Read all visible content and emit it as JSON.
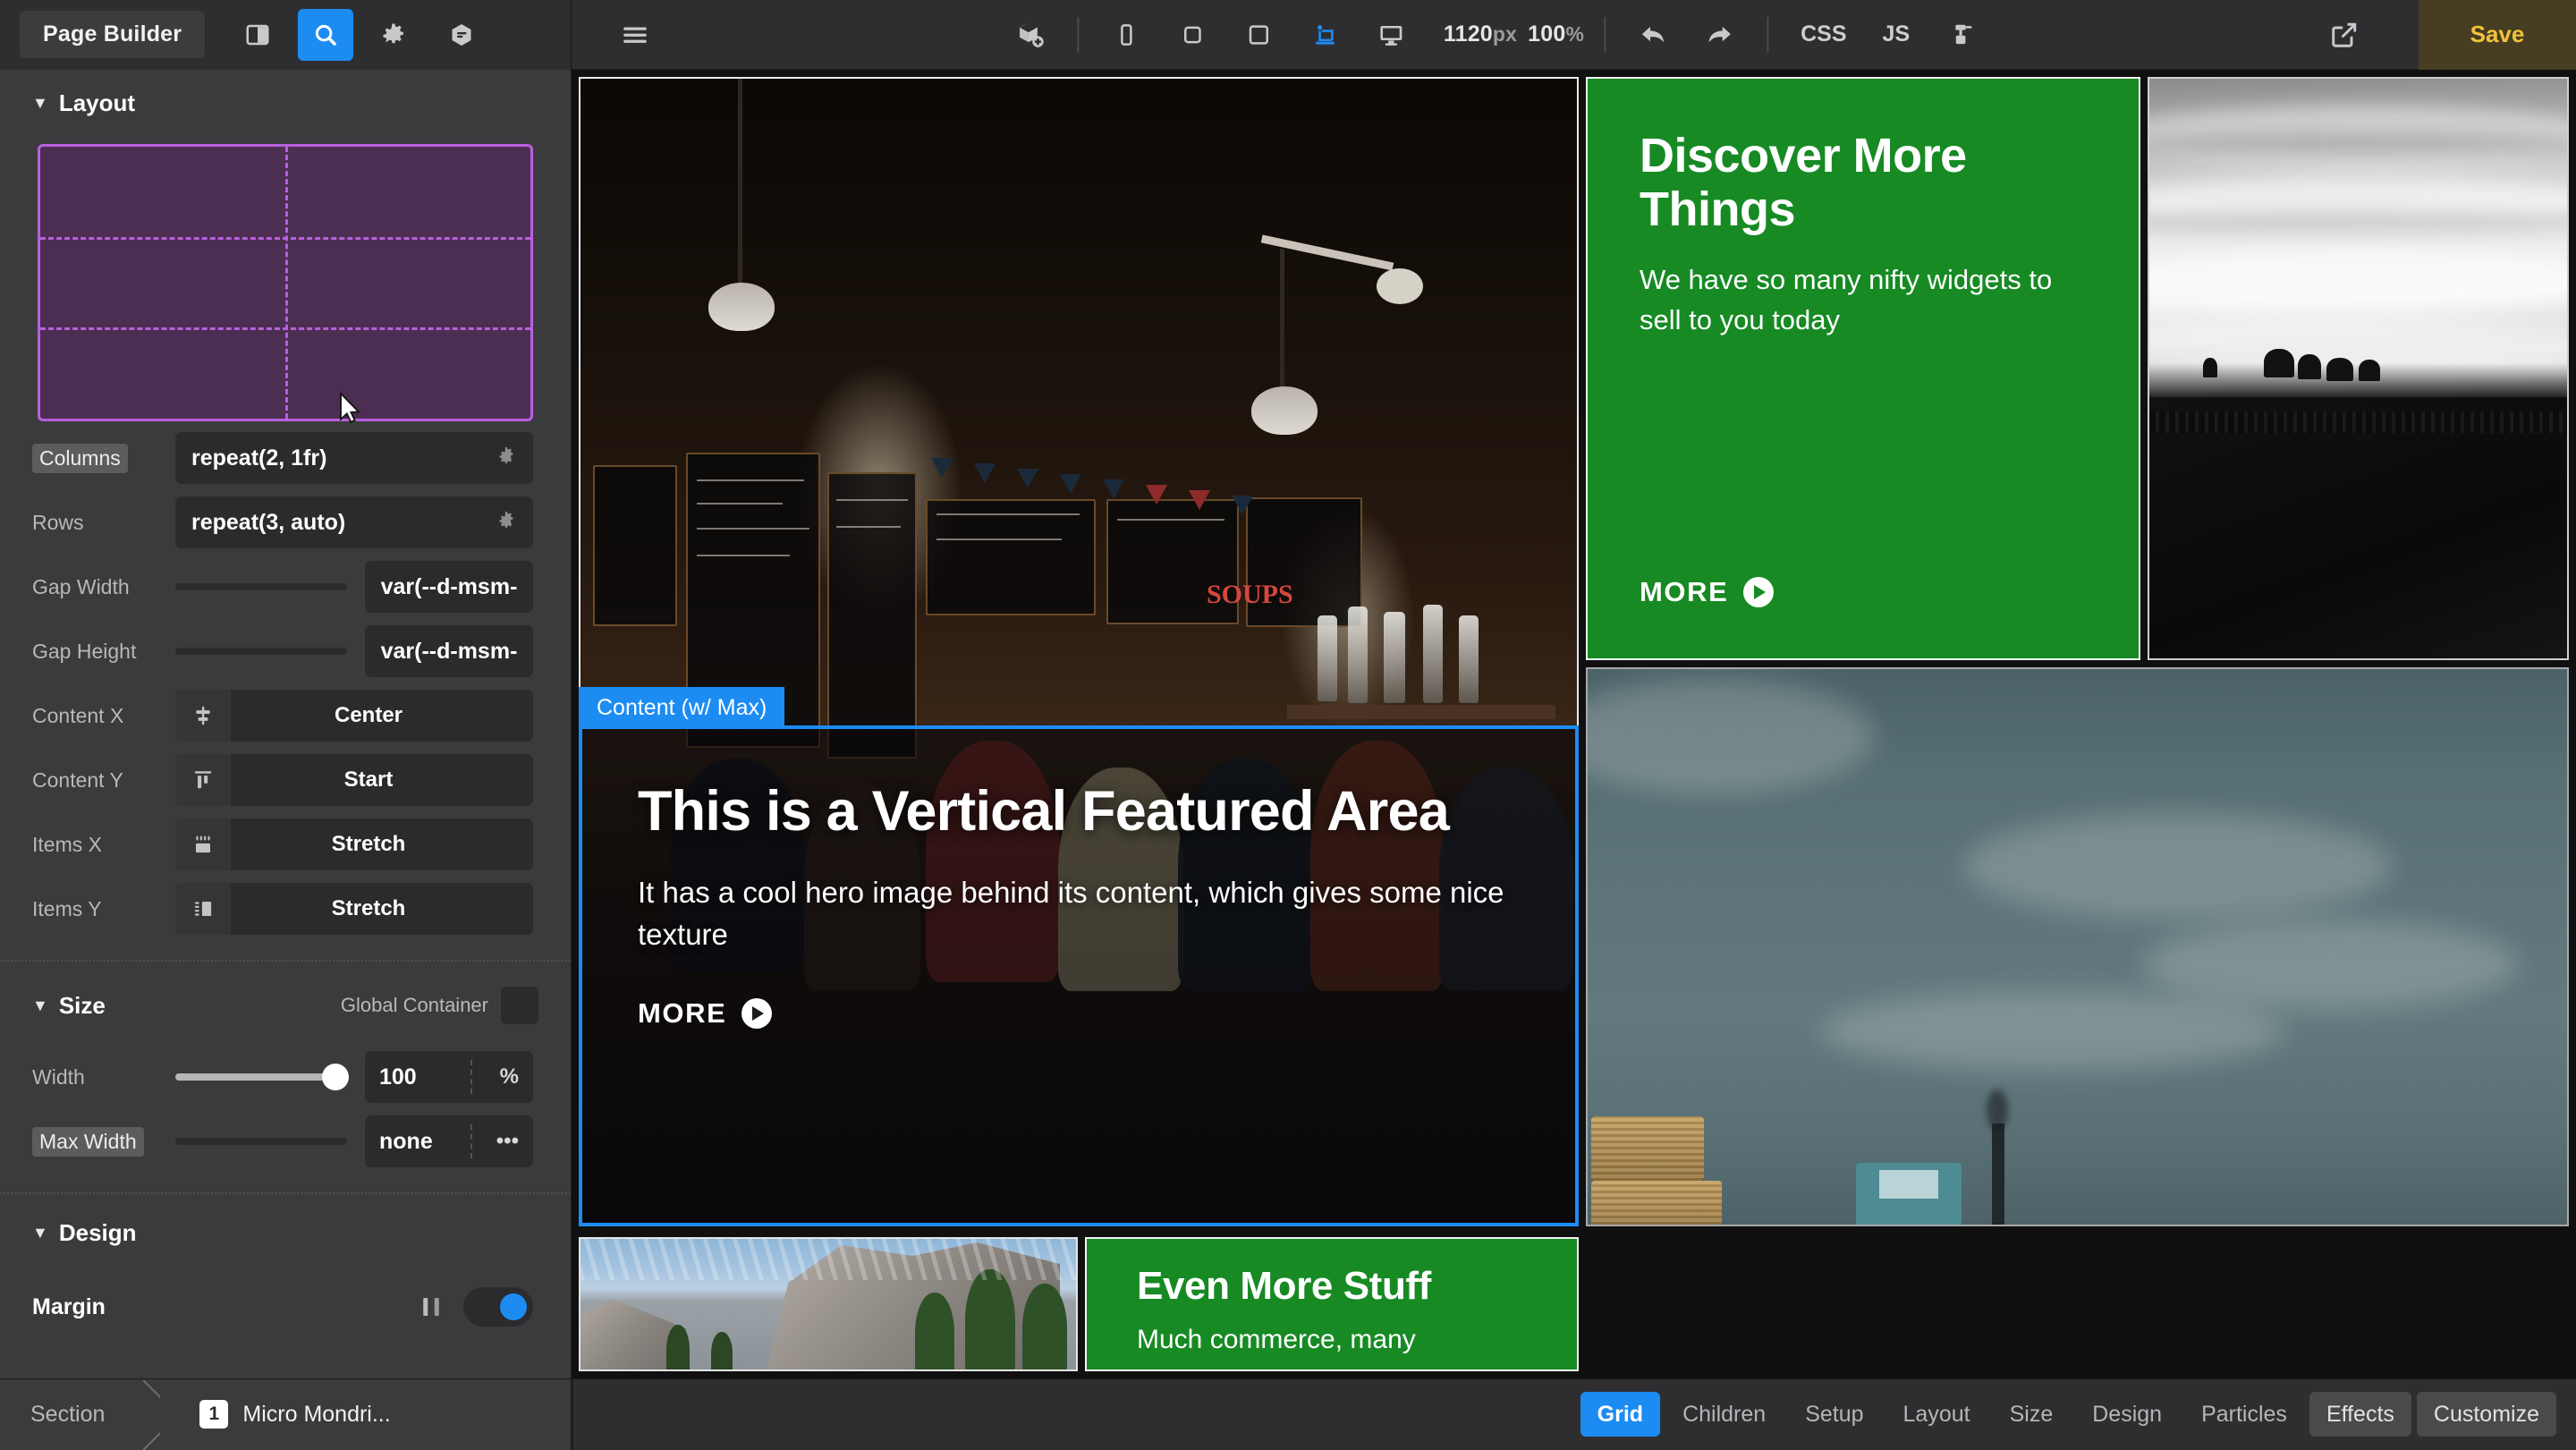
{
  "app": {
    "name": "Page Builder"
  },
  "toolbar": {
    "left_icons": [
      {
        "name": "sidebar-toggle-icon",
        "active": false
      },
      {
        "name": "search-icon",
        "active": true
      },
      {
        "name": "gear-icon",
        "active": false
      },
      {
        "name": "layers-hexagon-icon",
        "active": false
      }
    ],
    "menu_icon": "hamburger-menu-icon",
    "add_block_icon": "add-block-icon",
    "devices": [
      {
        "name": "mobile-view-icon",
        "active": false
      },
      {
        "name": "tablet-portrait-view-icon",
        "active": false
      },
      {
        "name": "tablet-landscape-view-icon",
        "active": false
      },
      {
        "name": "laptop-view-icon",
        "active": true
      },
      {
        "name": "desktop-view-icon",
        "active": false
      }
    ],
    "viewport_width": "1120",
    "viewport_width_unit": "px",
    "zoom": "100",
    "zoom_unit": "%",
    "undo_icon": "undo-arrow-icon",
    "redo_icon": "redo-arrow-icon",
    "css_label": "CSS",
    "js_label": "JS",
    "tools_icon": "drill-tool-icon",
    "preview_icon": "external-link-icon",
    "save_label": "Save"
  },
  "sidebar": {
    "layout": {
      "title": "Layout",
      "grid_preview": {
        "columns": 2,
        "rows": 3,
        "accent": "#b95fdd",
        "fill": "#4b2e52"
      },
      "fields": [
        {
          "label": "Columns",
          "value": "repeat(2, 1fr)",
          "highlight": true,
          "icon": "gear-icon"
        },
        {
          "label": "Rows",
          "value": "repeat(3, auto)",
          "highlight": false,
          "icon": "gear-icon"
        }
      ],
      "gaps": [
        {
          "label": "Gap Width",
          "value": "var(--d-msm-"
        },
        {
          "label": "Gap Height",
          "value": "var(--d-msm-"
        }
      ],
      "alignments": [
        {
          "label": "Content X",
          "value": "Center",
          "icon": "align-center-horizontal-icon"
        },
        {
          "label": "Content Y",
          "value": "Start",
          "icon": "align-start-vertical-icon"
        },
        {
          "label": "Items X",
          "value": "Stretch",
          "icon": "stretch-horizontal-icon"
        },
        {
          "label": "Items Y",
          "value": "Stretch",
          "icon": "stretch-vertical-icon"
        }
      ]
    },
    "size": {
      "title": "Size",
      "global_container_label": "Global Container",
      "width": {
        "label": "Width",
        "value": "100",
        "unit": "%",
        "slider_pct": 100
      },
      "max_width": {
        "label": "Max Width",
        "value": "none",
        "unit": "•••",
        "slider_pct": 0,
        "highlight": true
      }
    },
    "design": {
      "title": "Design",
      "margin_label": "Margin"
    }
  },
  "canvas": {
    "hero": {
      "badge": "Content (w/ Max)",
      "heading": "This is a Vertical Featured Area",
      "body": "It has a cool hero image behind its content, which gives some nice texture",
      "cta": "MORE",
      "accent": "#1c8cf3"
    },
    "card_green_1": {
      "heading": "Discover More Things",
      "body": "We have so many nifty widgets to sell to you today",
      "cta": "MORE",
      "bg": "#178a24"
    },
    "card_green_2": {
      "heading": "Even More Stuff",
      "body": "Much commerce, many",
      "bg": "#178a24"
    },
    "images": [
      {
        "name": "cafe-interior-photo"
      },
      {
        "name": "foggy-hills-bw-photo"
      },
      {
        "name": "teal-sky-hay-photo"
      },
      {
        "name": "granite-cliffs-photo"
      }
    ]
  },
  "statusbar": {
    "breadcrumb": [
      {
        "label": "Section",
        "num": null
      },
      {
        "label": "Micro Mondri...",
        "num": "1"
      }
    ],
    "tabs": [
      {
        "label": "Grid",
        "state": "active"
      },
      {
        "label": "Children",
        "state": "normal"
      },
      {
        "label": "Setup",
        "state": "normal"
      },
      {
        "label": "Layout",
        "state": "normal"
      },
      {
        "label": "Size",
        "state": "normal"
      },
      {
        "label": "Design",
        "state": "normal"
      },
      {
        "label": "Particles",
        "state": "normal"
      },
      {
        "label": "Effects",
        "state": "raised"
      },
      {
        "label": "Customize",
        "state": "raised"
      }
    ]
  }
}
